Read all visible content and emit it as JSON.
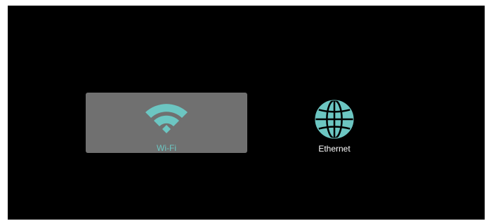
{
  "network_options": [
    {
      "label": "Wi-Fi",
      "icon": "wifi-icon",
      "selected": true
    },
    {
      "label": "Ethernet",
      "icon": "globe-icon",
      "selected": false
    }
  ],
  "colors": {
    "accent": "#6cc6c2",
    "selected_background": "#707070",
    "screen_background": "#000000",
    "label_text": "#ffffff"
  }
}
